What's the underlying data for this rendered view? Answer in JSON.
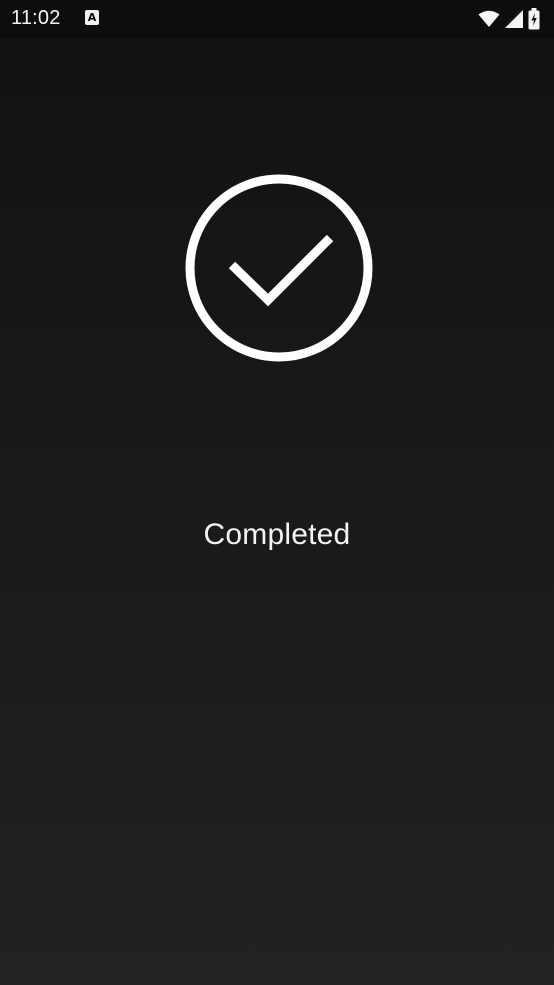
{
  "status_bar": {
    "time": "11:02",
    "app_icon_letter": "A",
    "icons": [
      "wifi-icon",
      "signal-icon",
      "battery-charging-icon"
    ]
  },
  "main": {
    "status_icon": "check-circle-icon",
    "message": "Completed"
  },
  "colors": {
    "background": "#111111",
    "foreground": "#ffffff"
  }
}
